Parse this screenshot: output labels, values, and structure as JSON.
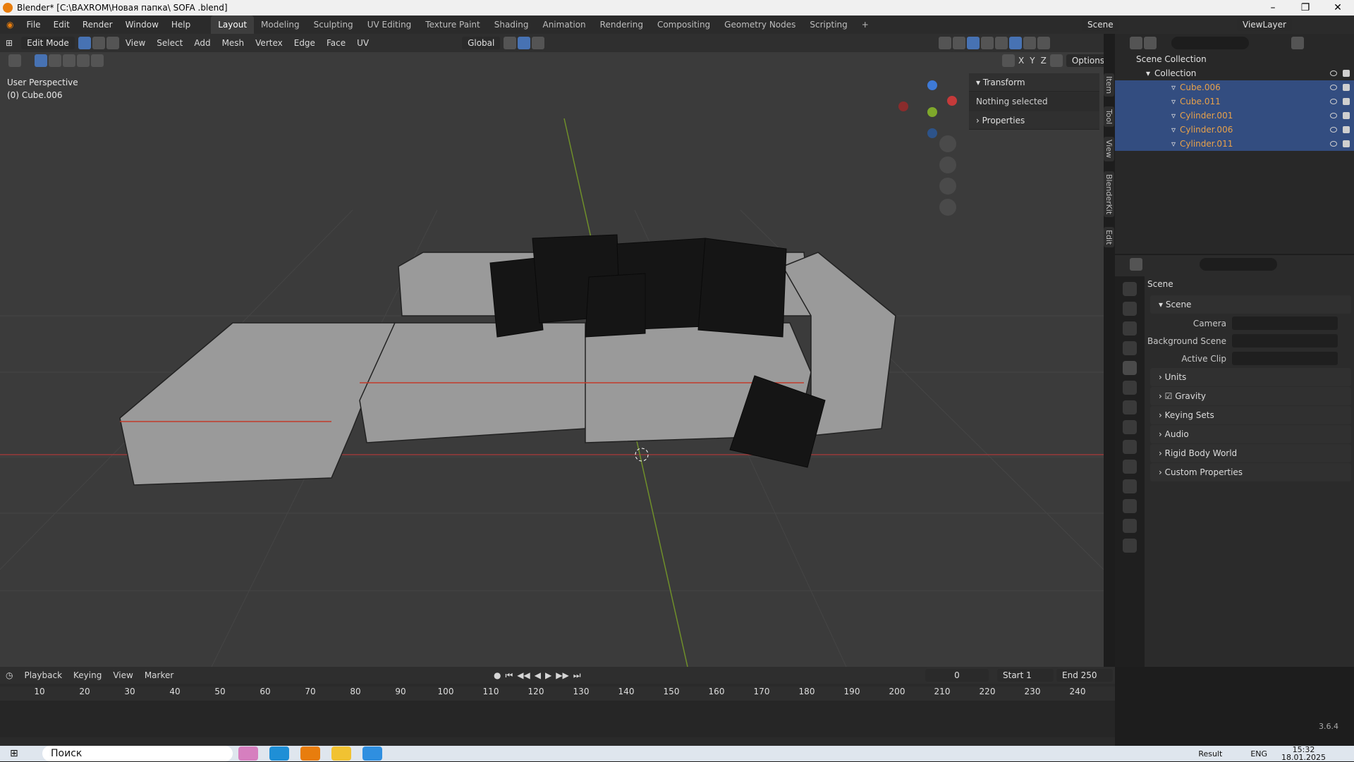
{
  "title_bar": {
    "title": "Blender* [C:\\BAXROM\\Новая папка\\ SOFA .blend]"
  },
  "menus": [
    "File",
    "Edit",
    "Render",
    "Window",
    "Help"
  ],
  "workspaces": [
    "Layout",
    "Modeling",
    "Sculpting",
    "UV Editing",
    "Texture Paint",
    "Shading",
    "Animation",
    "Rendering",
    "Compositing",
    "Geometry Nodes",
    "Scripting"
  ],
  "scene_selector": {
    "scene": "Scene",
    "view_layer": "ViewLayer"
  },
  "viewport": {
    "mode": "Edit Mode",
    "menus": [
      "View",
      "Select",
      "Add",
      "Mesh",
      "Vertex",
      "Edge",
      "Face",
      "UV"
    ],
    "orientation": "Global",
    "options": "Options",
    "axes": [
      "X",
      "Y",
      "Z"
    ],
    "perspective": "User Perspective",
    "object": "(0) Cube.006"
  },
  "n_panel": {
    "transform": "Transform",
    "status": "Nothing selected",
    "properties": "Properties",
    "tabs": [
      "Item",
      "Tool",
      "View",
      "BlenderKit",
      "Edit"
    ]
  },
  "outliner": {
    "scene_collection": "Scene Collection",
    "collection": "Collection",
    "objects": [
      "Cube.006",
      "Cube.011",
      "Cylinder.001",
      "Cylinder.006",
      "Cylinder.011"
    ]
  },
  "properties": {
    "header": "Scene",
    "section": "Scene",
    "fields": [
      {
        "label": "Camera"
      },
      {
        "label": "Background Scene"
      },
      {
        "label": "Active Clip"
      }
    ],
    "subsections": [
      "Units",
      "Gravity",
      "Keying Sets",
      "Audio",
      "Rigid Body World",
      "Custom Properties"
    ]
  },
  "timeline": {
    "menus": [
      "Playback",
      "Keying",
      "View",
      "Marker"
    ],
    "current_frame": "0",
    "start_label": "Start",
    "start": "1",
    "end_label": "End",
    "end": "250",
    "ticks": [
      "10",
      "20",
      "30",
      "40",
      "50",
      "60",
      "70",
      "80",
      "90",
      "100",
      "110",
      "120",
      "130",
      "140",
      "150",
      "160",
      "170",
      "180",
      "190",
      "200",
      "210",
      "220",
      "230",
      "240"
    ]
  },
  "version": "3.6.4",
  "taskbar": {
    "search": "Поиск",
    "result": "Result",
    "lang": "ENG",
    "time": "15:32",
    "date": "18.01.2025"
  },
  "colors": {
    "accent": "#4772b3",
    "orange": "#e8a14a",
    "x_axis": "#c53a3a",
    "y_axis": "#7fa82b"
  }
}
